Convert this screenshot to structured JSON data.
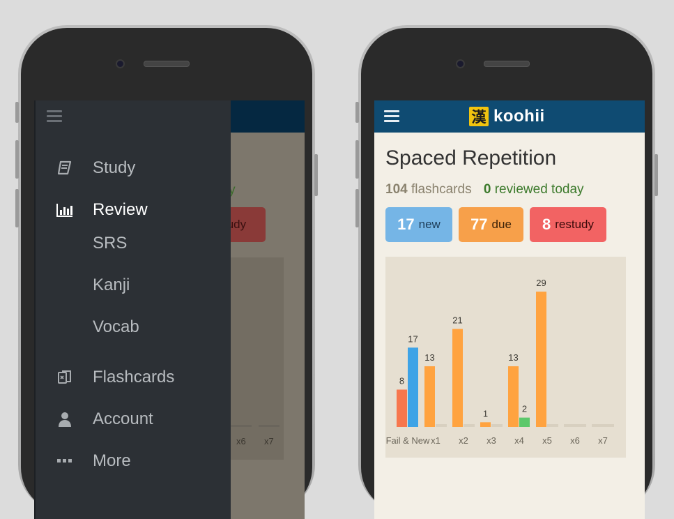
{
  "drawer": {
    "items": [
      {
        "label": "Study",
        "icon": "book-icon"
      },
      {
        "label": "Review",
        "icon": "bar-chart-icon",
        "active": true
      },
      {
        "label": "Flashcards",
        "icon": "cards-icon"
      },
      {
        "label": "Account",
        "icon": "user-icon"
      },
      {
        "label": "More",
        "icon": "more-icon"
      }
    ],
    "review_subitems": [
      "SRS",
      "Kanji",
      "Vocab"
    ]
  },
  "background": {
    "reviewed_fragment": "day",
    "restudy_fragment": "tudy",
    "x_labels": [
      "x6",
      "x7"
    ]
  },
  "header": {
    "logo_kanji": "漢",
    "logo_text": "koohii",
    "bar_color": "#0f4b72"
  },
  "page": {
    "title": "Spaced Repetition",
    "flashcard_count": "104",
    "flashcard_label": "flashcards",
    "reviewed_count": "0",
    "reviewed_label": "reviewed today"
  },
  "badges": {
    "new": {
      "count": "17",
      "label": "new",
      "color": "#75b5e6"
    },
    "due": {
      "count": "77",
      "label": "due",
      "color": "#f7a04a"
    },
    "restudy": {
      "count": "8",
      "label": "restudy",
      "color": "#f26363"
    }
  },
  "chart_data": {
    "type": "bar",
    "categories": [
      "Fail & New",
      "x1",
      "x2",
      "x3",
      "x4",
      "x5",
      "x6",
      "x7"
    ],
    "series": [
      {
        "values": [
          8,
          0,
          0,
          0,
          0,
          0,
          0,
          0
        ],
        "color": "#f7774e"
      },
      {
        "values": [
          17,
          0,
          0,
          0,
          0,
          0,
          0,
          0
        ],
        "color": "#3ea3e6"
      },
      {
        "values": [
          0,
          13,
          21,
          1,
          13,
          29,
          0,
          0
        ],
        "color": "#ffa340"
      },
      {
        "values": [
          0,
          0,
          0,
          0,
          2,
          0,
          0,
          0
        ],
        "color": "#5cc86a"
      }
    ],
    "ylim": [
      0,
      32
    ],
    "title": "",
    "xlabel": "",
    "ylabel": ""
  }
}
